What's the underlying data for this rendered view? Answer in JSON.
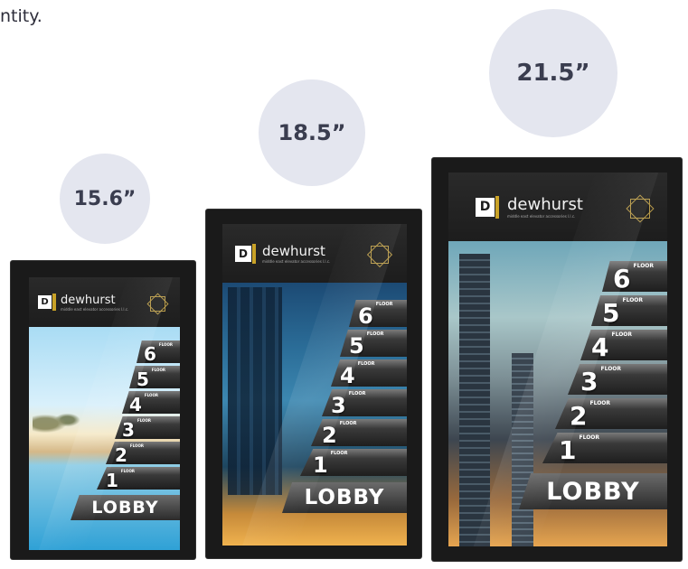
{
  "intro_text": "ntity.",
  "screens": [
    {
      "size_label": "15.6”",
      "brand": "dewhurst",
      "brand_sub": "middle east elevator accessories l.l.c.",
      "logo_letter": "D",
      "floors": [
        "6",
        "5",
        "4",
        "3",
        "2",
        "1"
      ],
      "floor_word": "FLOOR",
      "lobby": "LOBBY",
      "scene_icon": "beach-resort-image"
    },
    {
      "size_label": "18.5”",
      "brand": "dewhurst",
      "brand_sub": "middle east elevator accessories l.l.c.",
      "logo_letter": "D",
      "floors": [
        "6",
        "5",
        "4",
        "3",
        "2",
        "1"
      ],
      "floor_word": "FLOOR",
      "lobby": "LOBBY",
      "scene_icon": "city-night-image"
    },
    {
      "size_label": "21.5”",
      "brand": "dewhurst",
      "brand_sub": "middle east elevator accessories l.l.c.",
      "logo_letter": "D",
      "floors": [
        "6",
        "5",
        "4",
        "3",
        "2",
        "1"
      ],
      "floor_word": "FLOOR",
      "lobby": "LOBBY",
      "scene_icon": "skyscraper-dusk-image"
    }
  ],
  "colors": {
    "bubble": "#e4e6ef",
    "bubble_text": "#3a3d4f",
    "frame": "#1a1a1a",
    "emblem_gold": "#b79a4a"
  }
}
